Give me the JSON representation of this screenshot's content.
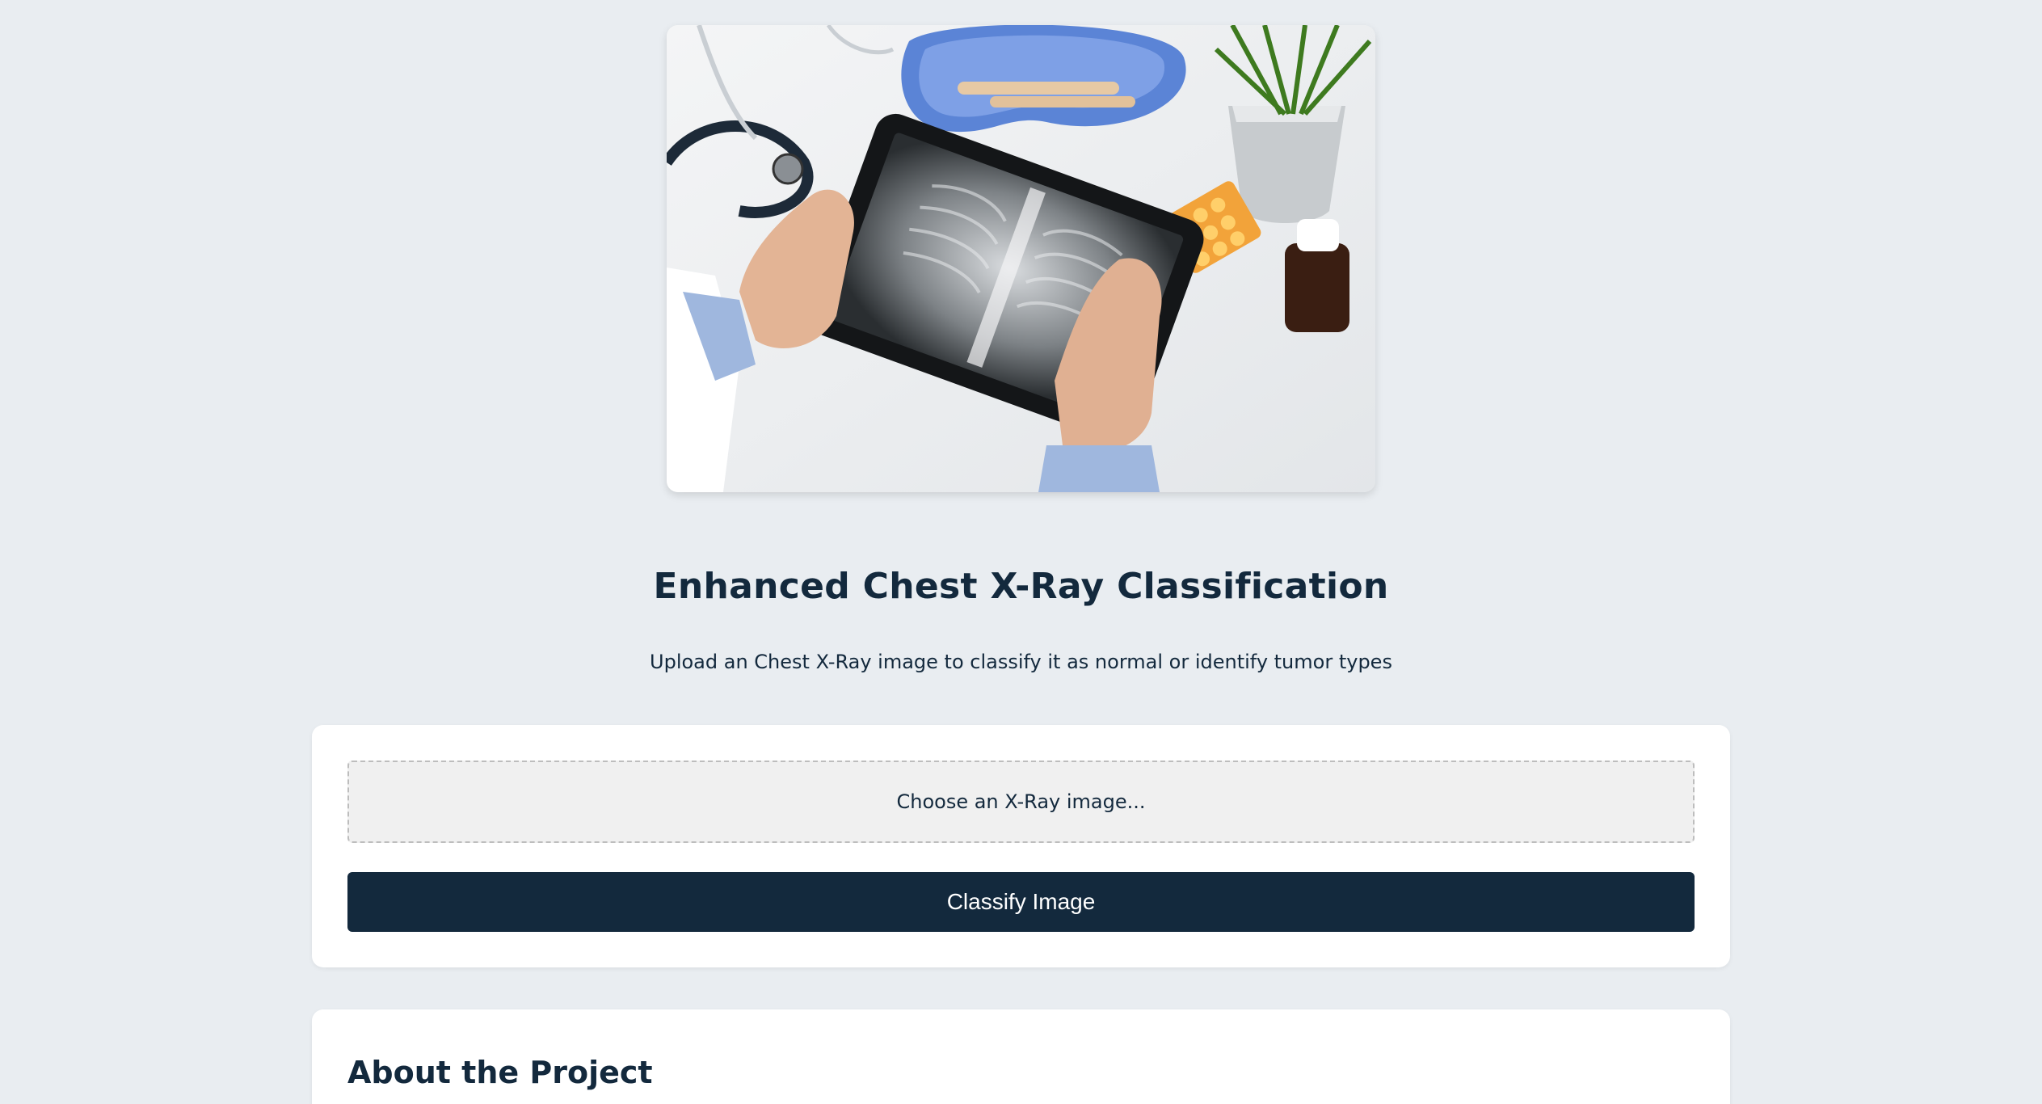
{
  "hero": {
    "image_alt": "Doctor holding a tablet showing a chest X-ray, with stethoscope, pills, bottle and plant"
  },
  "header": {
    "title": "Enhanced Chest X-Ray Classification",
    "subtitle": "Upload an Chest X-Ray image to classify it as normal or identify tumor types"
  },
  "upload": {
    "file_placeholder": "Choose an X-Ray image...",
    "classify_label": "Classify Image"
  },
  "about": {
    "heading": "About the Project"
  },
  "colors": {
    "background": "#e9edf1",
    "primary": "#13293d",
    "card": "#ffffff",
    "file_drop": "#f0f0f0"
  }
}
